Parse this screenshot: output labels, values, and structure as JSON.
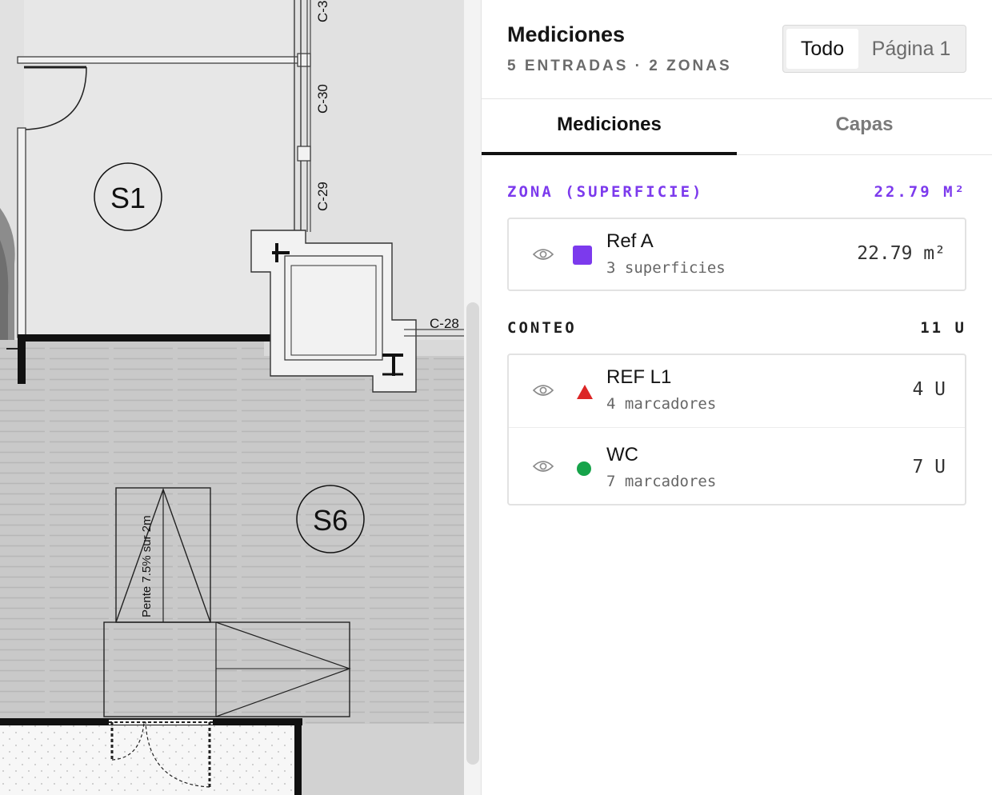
{
  "canvas": {
    "grid_labels": [
      "C-3",
      "C-30",
      "C-29",
      "C-28"
    ],
    "space_labels": [
      "S1",
      "S6"
    ],
    "ramp_text": "Pente 7.5% sur 2m"
  },
  "panel": {
    "title": "Mediciones",
    "subtitle": "5 ENTRADAS · 2 ZONAS",
    "scope": {
      "all": "Todo",
      "page": "Página 1"
    },
    "tabs": {
      "measurements": "Mediciones",
      "layers": "Capas"
    },
    "zona": {
      "label": "ZONA (SUPERFICIE)",
      "total": "22.79 M²",
      "items": [
        {
          "name": "Ref A",
          "sub": "3 superficies",
          "value": "22.79 m²",
          "color": "#7c3aed",
          "icon": "square-swatch-icon"
        }
      ]
    },
    "conteo": {
      "label": "CONTEO",
      "total": "11 U",
      "items": [
        {
          "name": "REF L1",
          "sub": "4 marcadores",
          "value": "4 U",
          "color": "#dc2626",
          "icon": "triangle-marker-icon"
        },
        {
          "name": "WC",
          "sub": "7 marcadores",
          "value": "7 U",
          "color": "#16a34a",
          "icon": "circle-marker-icon"
        }
      ]
    }
  }
}
